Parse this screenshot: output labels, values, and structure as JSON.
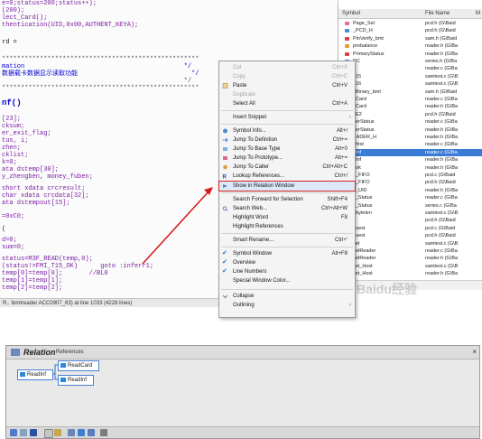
{
  "code": {
    "lines": [
      "e=0;status=200;status++);",
      "(200);",
      "lect_Card();",
      "thentication(UID,0x00,AUTHENT_KEYA);",
      "rd =",
      "****************************************************",
      "mation                                          */",
      "数据载卡数据显示读取功能                              */",
      "                                                */",
      "****************************************************",
      "nf()",
      "[23];",
      "cksum;",
      "er_exit_flag;",
      "tus, i;",
      "zhen;",
      "cklist;",
      "k=0;",
      "ata dstemp[30];",
      "y_zhengben, money_fuben;",
      "short xdata crcresult;",
      "char xdata crcdata[32];",
      "ata dstempout[15];",
      "=0xC0;",
      "(",
      "d=0;",
      "sum=0;",
      "status=M3F_READ(temp,0);",
      "(status!=FMI_T15_OK)      goto :inferr1;",
      "temp[0]=temp[0];       //BL0",
      "temp[1]=temp[1];",
      "temp[2]=temp[2];"
    ],
    "status_text": "R.. \\bmtreader ACC0907_63) at line 1033 (4228 lines)"
  },
  "symbol_panel": {
    "col_symbol": "Symbol",
    "col_file": "File Name",
    "col_m": "M",
    "rows": [
      {
        "name": "Page_Sel",
        "file": "pcd.h (G\\Baid"
      },
      {
        "name": "_PCD_H",
        "file": "pcd.h (G\\Baid"
      },
      {
        "name": "PinVerify_bmt",
        "file": "sam.h (G\\Baid"
      },
      {
        "name": "prebalance",
        "file": "reader.h (G\\Ba"
      },
      {
        "name": "PrimaryStatus",
        "file": "reader.h (G\\Ba"
      },
      {
        "name": "DC",
        "file": "series.h (G\\Ba"
      },
      {
        "name": "d",
        "file": "reader.c (G\\Ba"
      },
      {
        "name": "d15",
        "file": "samtest.c (G\\B"
      },
      {
        "name": "d16",
        "file": "samtest.c (G\\B"
      },
      {
        "name": "dBinary_bmt",
        "file": "sam.h (G\\Baid"
      },
      {
        "name": "dCard",
        "file": "reader.c (G\\Ba"
      },
      {
        "name": "dCard",
        "file": "reader.h (G\\Ba"
      },
      {
        "name": "dE2",
        "file": "pcd.h (G\\Baid"
      },
      {
        "name": "derStatus",
        "file": "reader.c (G\\Ba"
      },
      {
        "name": "derStatus",
        "file": "reader.h (G\\Ba"
      },
      {
        "name": "EADER_H",
        "file": "reader.h (G\\Ba"
      },
      {
        "name": "dfirst",
        "file": "reader.c (G\\Ba"
      },
      {
        "name": "dInf",
        "file": "reader.c (G\\Ba"
      },
      {
        "name": "dInf",
        "file": "reader.h (G\\Ba"
      },
      {
        "name": "dok",
        "file": "reader.h (G\\Ba"
      },
      {
        "name": "d_FIFO",
        "file": "pcd.c (G\\Baid"
      },
      {
        "name": "d_FIFO",
        "file": "pcd.h (G\\Baid"
      },
      {
        "name": "d_UID",
        "file": "reader.h (G\\Ba"
      },
      {
        "name": "v_Status",
        "file": "reader.c (G\\Ba"
      },
      {
        "name": "v_Status",
        "file": "series.c (G\\Ba"
      },
      {
        "name": "_bytelen",
        "file": "samtest.c (G\\B"
      },
      {
        "name": "q",
        "file": "pcd.h (G\\Baid"
      },
      {
        "name": "quest",
        "file": "pcd.c (G\\Baid"
      },
      {
        "name": "quest",
        "file": "pcd.h (G\\Baid"
      },
      {
        "name": "set",
        "file": "samtest.c (G\\B"
      },
      {
        "name": "setReader",
        "file": "reader.c (G\\Ba"
      },
      {
        "name": "setReader",
        "file": "reader.h (G\\Ba"
      },
      {
        "name": "set_Host",
        "file": "samtest.c (G\\B"
      },
      {
        "name": "set_Host",
        "file": "reader.h (G\\Ba"
      }
    ]
  },
  "context_menu": {
    "items": [
      {
        "label": "Cut",
        "shortcut": "Ctrl+X",
        "disabled": true
      },
      {
        "label": "Copy",
        "shortcut": "Ctrl+C",
        "disabled": true
      },
      {
        "label": "Paste",
        "shortcut": "Ctrl+V",
        "disabled": false
      },
      {
        "label": "Duplicate",
        "shortcut": "",
        "disabled": true
      },
      {
        "label": "Select All",
        "shortcut": "Ctrl+A",
        "disabled": false
      },
      {
        "label": "Insert Snippet",
        "shortcut": "",
        "disabled": false
      },
      {
        "label": "Symbol Info...",
        "shortcut": "Alt+/",
        "disabled": false
      },
      {
        "label": "Jump To Definition",
        "shortcut": "Ctrl+=",
        "disabled": false
      },
      {
        "label": "Jump To Base Type",
        "shortcut": "Alt+0",
        "disabled": false
      },
      {
        "label": "Jump To Prototype...",
        "shortcut": "Alt+=",
        "disabled": false
      },
      {
        "label": "Jump To Caller",
        "shortcut": "Ctrl+Alt+C",
        "disabled": false
      },
      {
        "label": "Lookup References...",
        "shortcut": "Ctrl+/",
        "disabled": false
      },
      {
        "label": "Show in Relation Window",
        "shortcut": "",
        "disabled": false
      },
      {
        "label": "Search Forward for Selection",
        "shortcut": "Shift+F4",
        "disabled": false
      },
      {
        "label": "Search Web...",
        "shortcut": "Ctrl+Alt+W",
        "disabled": false
      },
      {
        "label": "Highlight Word",
        "shortcut": "F8",
        "disabled": false
      },
      {
        "label": "Highlight References",
        "shortcut": "",
        "disabled": false
      },
      {
        "label": "Smart Rename...",
        "shortcut": "Ctrl+'",
        "disabled": false
      },
      {
        "label": "Symbol Window",
        "shortcut": "Alt+F8",
        "disabled": false
      },
      {
        "label": "Overview",
        "shortcut": "",
        "disabled": false
      },
      {
        "label": "Line Numbers",
        "shortcut": "",
        "disabled": false
      },
      {
        "label": "Special Window Color...",
        "shortcut": "",
        "disabled": false
      },
      {
        "label": "Collapse",
        "shortcut": "",
        "disabled": false
      },
      {
        "label": "Outlining",
        "shortcut": "",
        "disabled": false
      }
    ]
  },
  "relation": {
    "title": "Relation",
    "subtitle": "References",
    "close": "×",
    "root": "ReadInf",
    "children": [
      "ReadCard",
      "ReadInf"
    ]
  },
  "watermark": "Baidu经验"
}
